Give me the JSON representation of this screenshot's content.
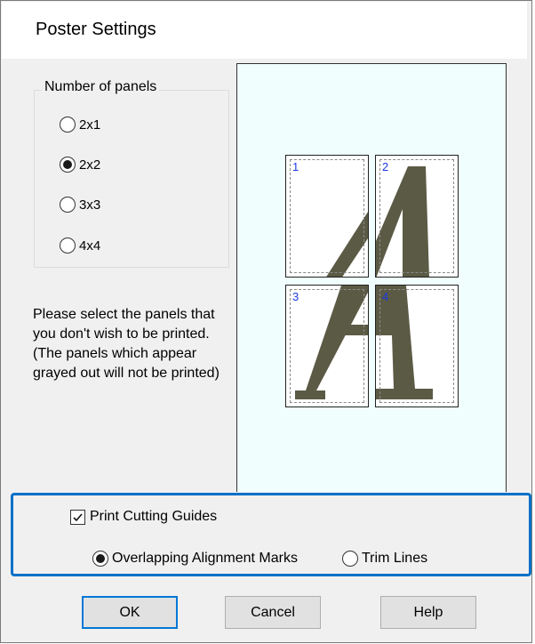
{
  "dialog": {
    "title": "Poster Settings"
  },
  "panels_group": {
    "legend": "Number of panels",
    "options": [
      {
        "label": "2x1",
        "selected": false
      },
      {
        "label": "2x2",
        "selected": true
      },
      {
        "label": "3x3",
        "selected": false
      },
      {
        "label": "4x4",
        "selected": false
      }
    ]
  },
  "note": "Please select the panels that you don't wish to be printed. (The panels which appear grayed out will not be printed)",
  "preview": {
    "panels": [
      "1",
      "2",
      "3",
      "4"
    ],
    "background_color": "#f0fffe",
    "glyph_color": "#5b5a45"
  },
  "cutting_guides": {
    "checkbox_label": "Print Cutting Guides",
    "checked": true,
    "options": [
      {
        "label": "Overlapping Alignment Marks",
        "selected": true
      },
      {
        "label": "Trim Lines",
        "selected": false
      }
    ],
    "highlight_color": "#0070c8"
  },
  "buttons": {
    "ok": "OK",
    "cancel": "Cancel",
    "help": "Help"
  }
}
